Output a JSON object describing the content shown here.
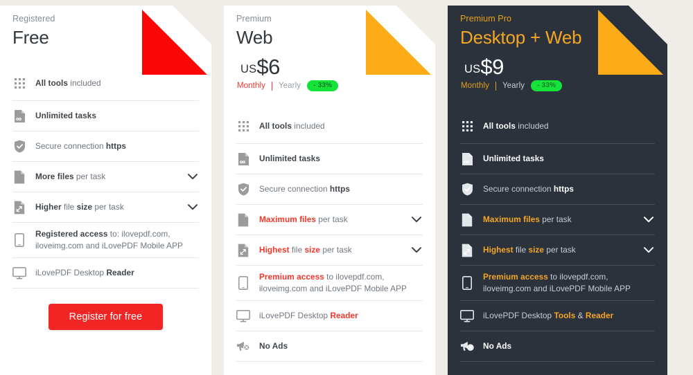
{
  "page": {
    "background_color": "#f0ede8",
    "accent_red": "#f4372a",
    "accent_amber": "#f5a623",
    "badge_green": "#14e33a"
  },
  "plans": [
    {
      "eyebrow": "Registered",
      "name": "Free",
      "fold_color": "#fa0606",
      "theme": "light",
      "price": null,
      "billing": null,
      "features": [
        {
          "icon": "grid-icon",
          "parts": [
            {
              "t": "All tools",
              "s": "bold"
            },
            {
              "t": " included",
              "s": "normal"
            }
          ],
          "chevron": false
        },
        {
          "icon": "infinite-tasks-icon",
          "parts": [
            {
              "t": "Unlimited tasks",
              "s": "bold"
            }
          ],
          "chevron": false
        },
        {
          "icon": "shield-check-icon",
          "parts": [
            {
              "t": "Secure connection ",
              "s": "normal"
            },
            {
              "t": "https",
              "s": "bold"
            }
          ],
          "chevron": false
        },
        {
          "icon": "file-icon",
          "parts": [
            {
              "t": "More files",
              "s": "bold"
            },
            {
              "t": " per task",
              "s": "normal"
            }
          ],
          "chevron": true
        },
        {
          "icon": "file-resize-icon",
          "parts": [
            {
              "t": "Higher",
              "s": "bold"
            },
            {
              "t": " file ",
              "s": "normal"
            },
            {
              "t": "size",
              "s": "bold"
            },
            {
              "t": " per task",
              "s": "normal"
            }
          ],
          "chevron": true
        },
        {
          "icon": "mobile-icon",
          "parts": [
            {
              "t": "Registered access",
              "s": "bold"
            },
            {
              "t": " to: ilovepdf.com, iloveimg.com and iLovePDF Mobile APP",
              "s": "normal"
            }
          ],
          "chevron": false
        },
        {
          "icon": "desktop-icon",
          "parts": [
            {
              "t": "iLovePDF Desktop ",
              "s": "normal"
            },
            {
              "t": "Reader",
              "s": "bold"
            }
          ],
          "chevron": false
        }
      ],
      "cta": "Register for free"
    },
    {
      "eyebrow": "Premium",
      "name": "Web",
      "fold_color": "#fbab16",
      "theme": "light",
      "price": {
        "currency": "US",
        "amount": "$6"
      },
      "billing": {
        "monthly": "Monthly",
        "yearly": "Yearly",
        "discount": "- 33%",
        "selected": "Monthly"
      },
      "features": [
        {
          "icon": "grid-icon",
          "parts": [
            {
              "t": "All tools",
              "s": "bold"
            },
            {
              "t": " included",
              "s": "normal"
            }
          ],
          "chevron": false
        },
        {
          "icon": "infinite-tasks-icon",
          "parts": [
            {
              "t": "Unlimited tasks",
              "s": "bold"
            }
          ],
          "chevron": false
        },
        {
          "icon": "shield-check-icon",
          "parts": [
            {
              "t": "Secure connection ",
              "s": "normal"
            },
            {
              "t": "https",
              "s": "bold"
            }
          ],
          "chevron": false
        },
        {
          "icon": "file-icon",
          "parts": [
            {
              "t": "Maximum files",
              "s": "hl"
            },
            {
              "t": " per task",
              "s": "normal"
            }
          ],
          "chevron": true
        },
        {
          "icon": "file-resize-icon",
          "parts": [
            {
              "t": "Highest",
              "s": "hl"
            },
            {
              "t": " file ",
              "s": "normal"
            },
            {
              "t": "size",
              "s": "hl"
            },
            {
              "t": " per task",
              "s": "normal"
            }
          ],
          "chevron": true
        },
        {
          "icon": "mobile-icon",
          "parts": [
            {
              "t": "Premium access",
              "s": "hl"
            },
            {
              "t": " to ilovepdf.com, iloveimg.com and iLovePDF Mobile APP",
              "s": "normal"
            }
          ],
          "chevron": false
        },
        {
          "icon": "desktop-icon",
          "parts": [
            {
              "t": "iLovePDF Desktop ",
              "s": "normal"
            },
            {
              "t": "Reader",
              "s": "hl"
            }
          ],
          "chevron": false
        },
        {
          "icon": "no-ads-icon",
          "parts": [
            {
              "t": "No Ads",
              "s": "bold"
            }
          ],
          "chevron": false
        }
      ],
      "cta": null
    },
    {
      "eyebrow": "Premium Pro",
      "name": "Desktop + Web",
      "fold_color": "#fbab16",
      "theme": "dark",
      "price": {
        "currency": "US",
        "amount": "$9"
      },
      "billing": {
        "monthly": "Monthly",
        "yearly": "Yearly",
        "discount": "- 33%",
        "selected": "Monthly"
      },
      "features": [
        {
          "icon": "grid-icon",
          "parts": [
            {
              "t": "All tools",
              "s": "bold"
            },
            {
              "t": " included",
              "s": "normal"
            }
          ],
          "chevron": false
        },
        {
          "icon": "infinite-tasks-icon",
          "parts": [
            {
              "t": "Unlimited tasks",
              "s": "bold"
            }
          ],
          "chevron": false
        },
        {
          "icon": "shield-check-icon",
          "parts": [
            {
              "t": "Secure connection ",
              "s": "normal"
            },
            {
              "t": "https",
              "s": "bold"
            }
          ],
          "chevron": false
        },
        {
          "icon": "file-icon",
          "parts": [
            {
              "t": "Maximum files",
              "s": "hl"
            },
            {
              "t": " per task",
              "s": "normal"
            }
          ],
          "chevron": true
        },
        {
          "icon": "file-resize-icon",
          "parts": [
            {
              "t": "Highest",
              "s": "hl"
            },
            {
              "t": " file ",
              "s": "normal"
            },
            {
              "t": "size",
              "s": "hl"
            },
            {
              "t": " per task",
              "s": "normal"
            }
          ],
          "chevron": true
        },
        {
          "icon": "mobile-icon",
          "parts": [
            {
              "t": "Premium access",
              "s": "hl"
            },
            {
              "t": " to ilovepdf.com, iloveimg.com and iLovePDF Mobile APP",
              "s": "normal"
            }
          ],
          "chevron": false
        },
        {
          "icon": "desktop-icon",
          "parts": [
            {
              "t": "iLovePDF Desktop ",
              "s": "normal"
            },
            {
              "t": "Tools",
              "s": "hl"
            },
            {
              "t": " & ",
              "s": "normal"
            },
            {
              "t": "Reader",
              "s": "hl"
            }
          ],
          "chevron": false
        },
        {
          "icon": "no-ads-icon",
          "parts": [
            {
              "t": "No Ads",
              "s": "bold"
            }
          ],
          "chevron": false
        }
      ],
      "cta": null
    }
  ]
}
